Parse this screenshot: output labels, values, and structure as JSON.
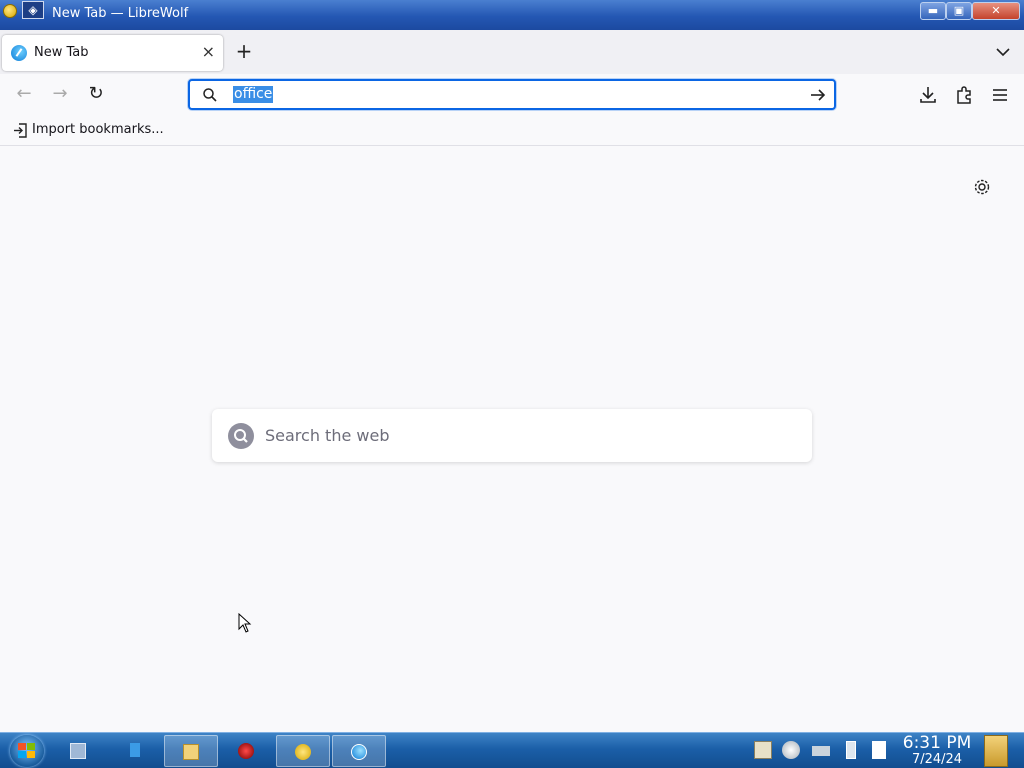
{
  "window": {
    "title": "New Tab — LibreWolf",
    "controls": {
      "minimize": "▬",
      "maximize": "▣",
      "close": "✕"
    }
  },
  "tabs": [
    {
      "label": "New Tab",
      "icon": "librewolf-icon",
      "active": true,
      "close_glyph": "×"
    }
  ],
  "tabstrip": {
    "new_tab_glyph": "+"
  },
  "navbar": {
    "back_glyph": "←",
    "forward_glyph": "→",
    "reload_glyph": "↻",
    "url_value": "office",
    "url_selected": true
  },
  "bookmarks": {
    "import_label": "Import bookmarks..."
  },
  "content": {
    "search_placeholder": "Search the web"
  },
  "taskbar": {
    "items": [
      {
        "icon": "system-icon",
        "active": false
      },
      {
        "icon": "pin-icon",
        "active": false
      },
      {
        "icon": "file-manager-icon",
        "active": true
      },
      {
        "icon": "media-icon",
        "active": false
      },
      {
        "icon": "librewolf-dev-icon",
        "active": true
      },
      {
        "icon": "librewolf-icon",
        "active": true
      }
    ],
    "tray": [
      "clipboard-icon",
      "disc-icon",
      "network-icon",
      "battery-icon",
      "document-icon"
    ],
    "time": "6:31 PM",
    "date": "7/24/24"
  },
  "colors": {
    "accent": "#0b66e4",
    "selection": "#3a8ee6",
    "taskbar": "#1b5fa8"
  }
}
